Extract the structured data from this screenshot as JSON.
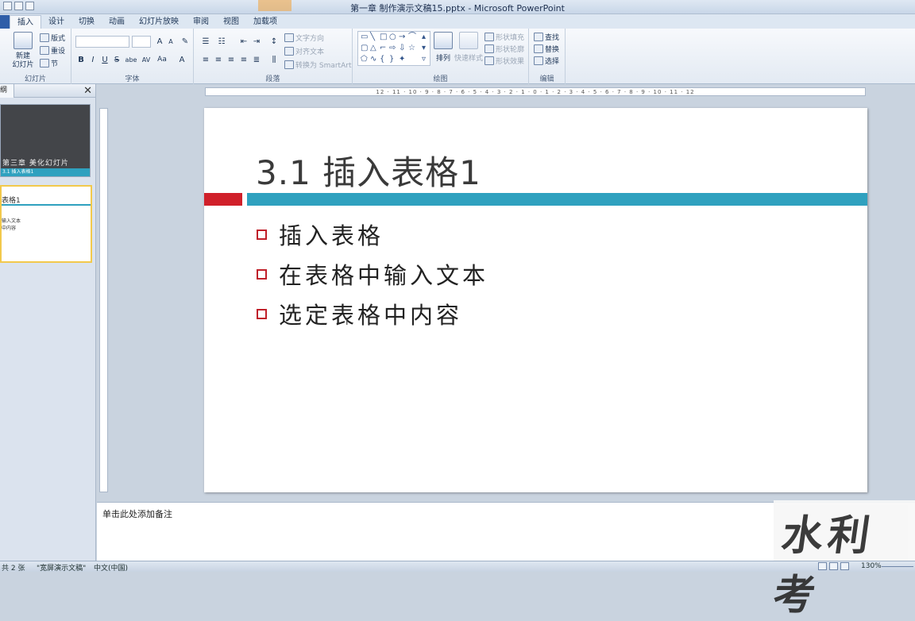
{
  "window": {
    "title": "第一章 制作演示文稿15.pptx - Microsoft PowerPoint"
  },
  "tabs": [
    "插入",
    "设计",
    "切换",
    "动画",
    "幻灯片放映",
    "审阅",
    "视图",
    "加载项"
  ],
  "ribbon": {
    "slides_group": {
      "new_slide": "新建\n幻灯片",
      "layout": "版式",
      "reset": "重设",
      "section": "节",
      "label": "幻灯片"
    },
    "font_group": {
      "label": "字体",
      "bold": "B",
      "italic": "I",
      "underline": "U",
      "strike": "S",
      "shadow": "abe",
      "spacing": "AV",
      "case": "Aa",
      "color": "A",
      "grow": "A",
      "shrink": "A"
    },
    "paragraph_group": {
      "label": "段落",
      "text_direction": "文字方向",
      "align_text": "对齐文本",
      "smartart": "转换为 SmartArt"
    },
    "drawing_group": {
      "label": "绘图",
      "arrange": "排列",
      "quick_styles": "快速样式",
      "fill": "形状填充",
      "outline": "形状轮廓",
      "effects": "形状效果"
    },
    "editing_group": {
      "label": "编辑",
      "find": "查找",
      "replace": "替换",
      "select": "选择"
    }
  },
  "left_panel": {
    "tab": "纲",
    "thumb1": {
      "text": "第三章 美化幻灯片",
      "bar": "3.1 插入表格1"
    },
    "thumb2": {
      "title": "表格1",
      "lines": [
        "输入文本",
        "中内容"
      ]
    }
  },
  "ruler": {
    "h_ticks": "12 · 11 · 10 · 9 · 8 · 7 · 6 · 5 · 4 · 3 · 2 · 1 · 0 · 1 · 2 · 3 · 4 · 5 · 6 · 7 · 8 · 9 · 10 · 11 · 12"
  },
  "slide": {
    "title": "3.1 插入表格1",
    "bullets": [
      "插入表格",
      "在表格中输入文本",
      "选定表格中内容"
    ]
  },
  "notes": {
    "placeholder": "单击此处添加备注"
  },
  "watermark": {
    "text": "水利考"
  },
  "status": {
    "slide_count": "共 2 张",
    "theme": "\"宽屏演示文稿\"",
    "language": "中文(中国)",
    "zoom": "130%"
  },
  "colors": {
    "accent_blue": "#2fa1bf",
    "accent_red": "#d0202a"
  }
}
